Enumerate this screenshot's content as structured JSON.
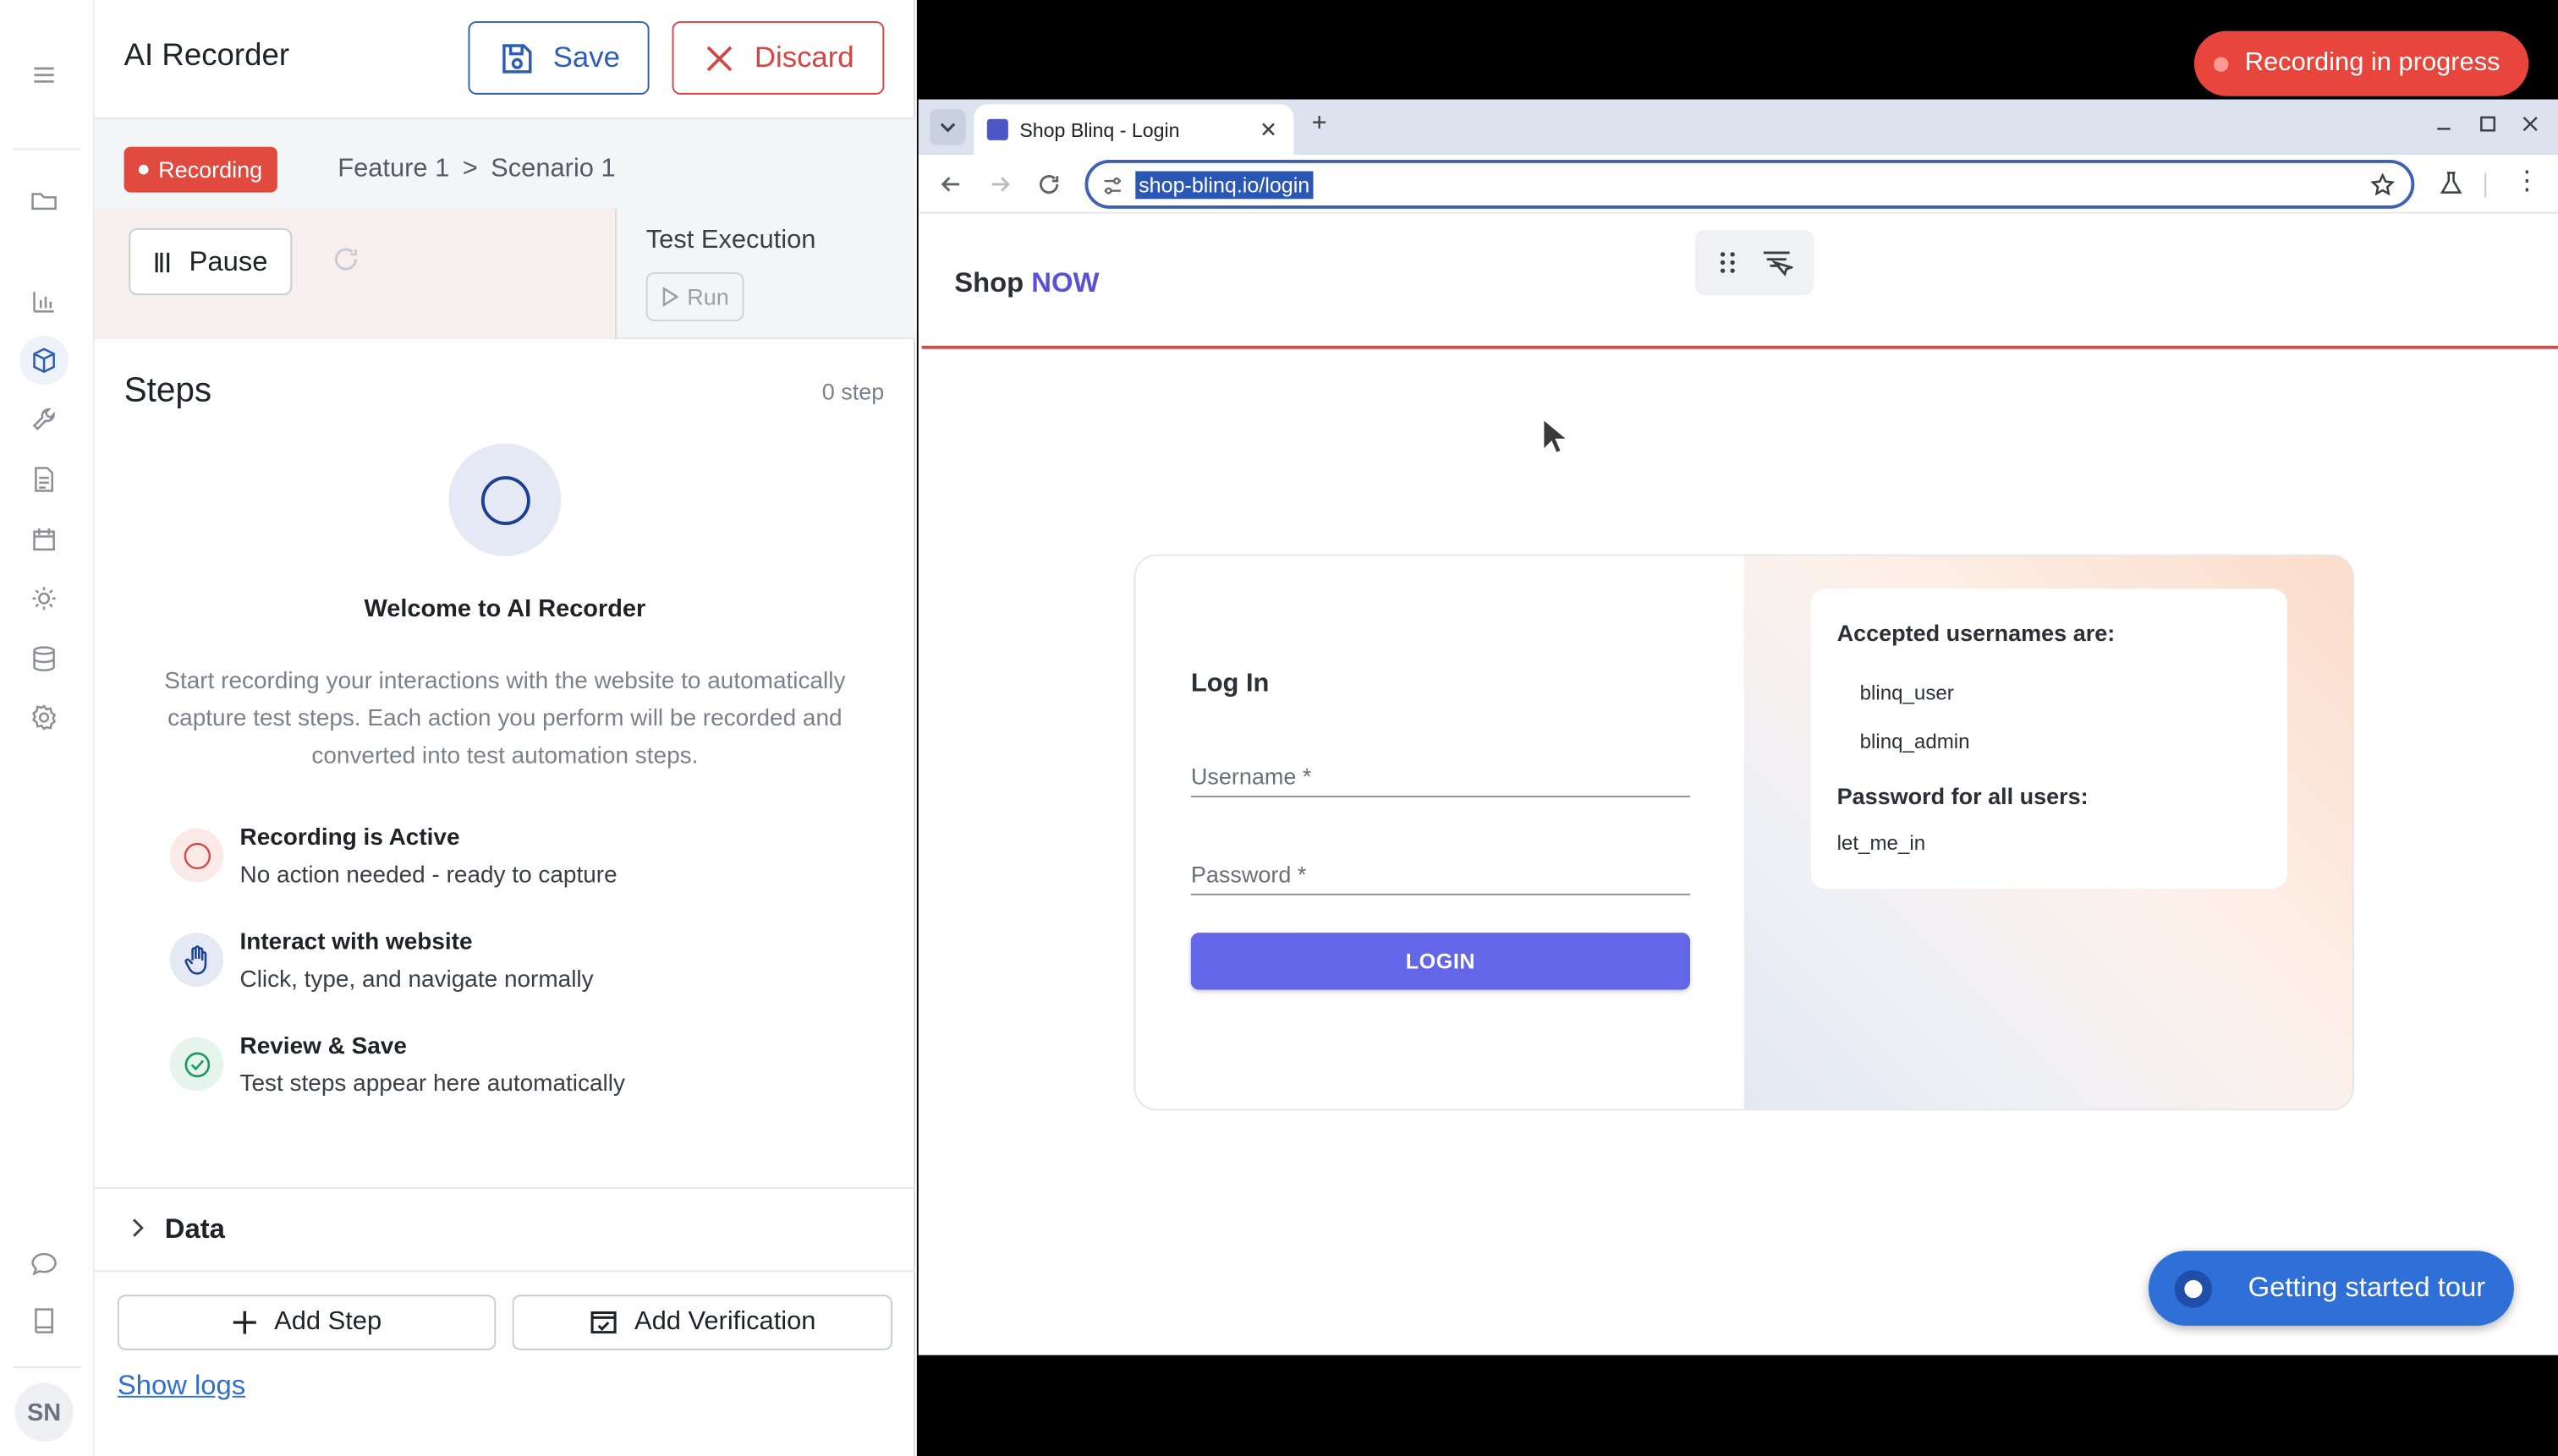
{
  "rail": {
    "avatar_initials": "SN",
    "icons": [
      "menu-icon",
      "folder-icon",
      "chart-icon",
      "cube-icon",
      "wrench-icon",
      "document-icon",
      "calendar-icon",
      "gear-alt-icon",
      "database-icon",
      "settings-icon",
      "chat-icon",
      "book-icon"
    ]
  },
  "recorder": {
    "title": "AI Recorder",
    "save_label": "Save",
    "discard_label": "Discard",
    "status_badge": "Recording",
    "breadcrumb": {
      "feature": "Feature 1",
      "separator": ">",
      "scenario": "Scenario 1"
    },
    "pause_label": "Pause",
    "test_execution_title": "Test Execution",
    "run_label": "Run",
    "steps_title": "Steps",
    "steps_count": "0 step",
    "welcome_title": "Welcome to AI Recorder",
    "welcome_text": "Start recording your interactions with the website to automatically capture test steps. Each action you perform will be recorded and converted into test automation steps.",
    "tips": [
      {
        "title": "Recording is Active",
        "subtitle": "No action needed - ready to capture"
      },
      {
        "title": "Interact with website",
        "subtitle": "Click, type, and navigate normally"
      },
      {
        "title": "Review & Save",
        "subtitle": "Test steps appear here automatically"
      }
    ],
    "data_section_title": "Data",
    "add_step_label": "Add Step",
    "add_verification_label": "Add Verification",
    "show_logs_label": "Show logs"
  },
  "overlay": {
    "recording_pill": "Recording in progress",
    "tour_button": "Getting started tour"
  },
  "browser": {
    "tab_title": "Shop Blinq - Login",
    "url": "shop-blinq.io/login"
  },
  "site": {
    "logo_shop": "Shop",
    "logo_now": "NOW",
    "login_title": "Log In",
    "username_label": "Username *",
    "password_label": "Password *",
    "login_button": "LOGIN",
    "accepted_title": "Accepted usernames are:",
    "usernames": [
      "blinq_user",
      "blinq_admin"
    ],
    "password_title": "Password for all users:",
    "password_value": "let_me_in"
  },
  "colors": {
    "accent_blue": "#2f5db3",
    "danger_red": "#d64541",
    "recording_red": "#e8453c",
    "login_purple": "#6366e6",
    "tour_blue": "#2e6fd8"
  }
}
